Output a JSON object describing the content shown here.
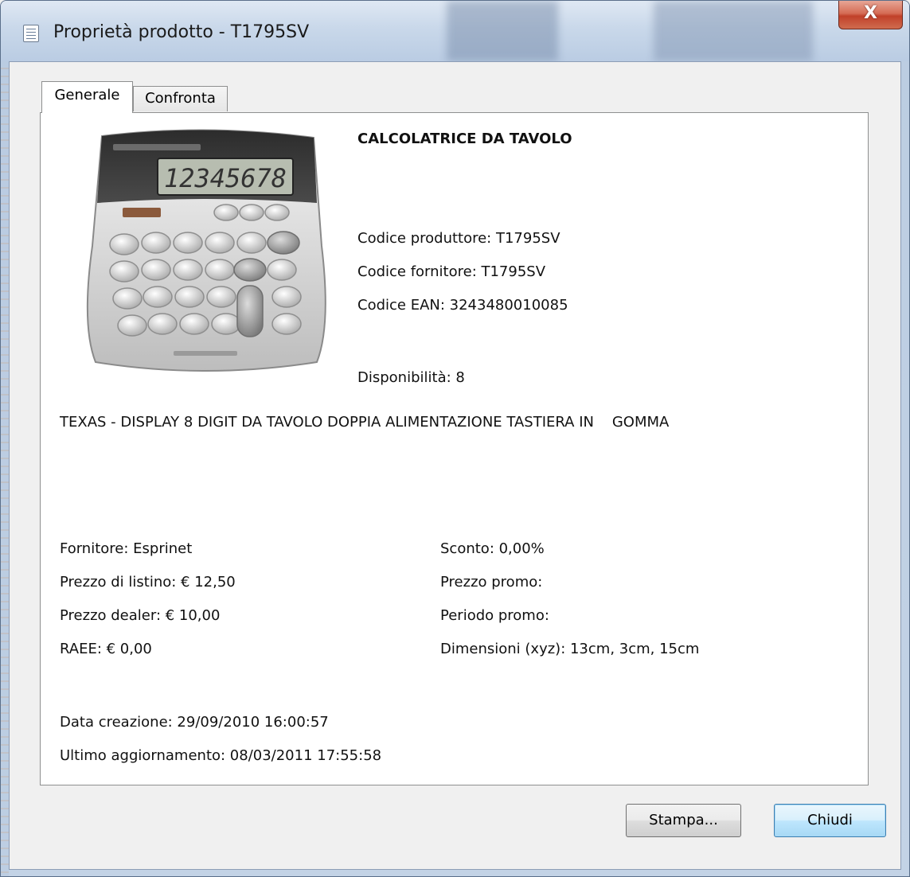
{
  "window": {
    "title": "Proprietà prodotto - T1795SV",
    "close_label": "X"
  },
  "tabs": [
    {
      "label": "Generale"
    },
    {
      "label": "Confronta"
    }
  ],
  "product": {
    "name": "CALCOLATRICE DA TAVOLO",
    "manufacturer_code": "Codice produttore: T1795SV",
    "supplier_code": "Codice fornitore: T1795SV",
    "ean_code": "Codice EAN: 3243480010085",
    "availability": "Disponibilità: 8",
    "description": "TEXAS - DISPLAY 8 DIGIT DA TAVOLO DOPPIA ALIMENTAZIONE TASTIERA IN    GOMMA",
    "display_digits": "12345678"
  },
  "pricing": {
    "supplier": "Fornitore: Esprinet",
    "list_price": "Prezzo di listino: € 12,50",
    "dealer_price": "Prezzo dealer: € 10,00",
    "raee": "RAEE: € 0,00",
    "discount": "Sconto: 0,00%",
    "promo_price": "Prezzo promo:",
    "promo_period": "Periodo promo:",
    "dimensions": "Dimensioni (xyz): 13cm, 3cm, 15cm"
  },
  "dates": {
    "created": "Data creazione: 29/09/2010 16:00:57",
    "updated": "Ultimo aggiornamento: 08/03/2011 17:55:58"
  },
  "buttons": {
    "print": "Stampa...",
    "close": "Chiudi"
  }
}
